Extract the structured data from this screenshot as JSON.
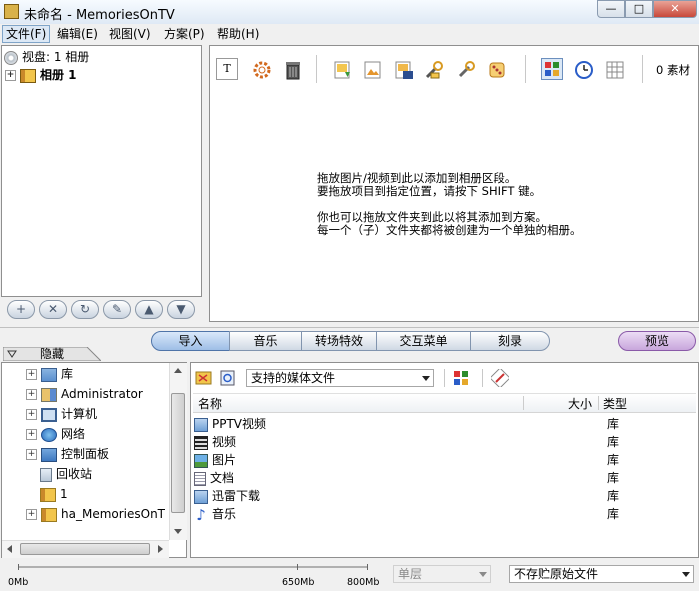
{
  "window": {
    "title": "未命名 - MemoriesOnTV",
    "min_glyph": "—",
    "max_glyph": "□",
    "close_glyph": "✕"
  },
  "menu": [
    "文件(F)",
    "编辑(E)",
    "视图(V)",
    "方案(P)",
    "帮助(H)"
  ],
  "album_tree": {
    "disc_label": "视盘: 1 相册",
    "album_label": "相册 1"
  },
  "album_toolbar": [
    "+",
    "✕",
    "↻",
    "✎",
    "▲",
    "▼"
  ],
  "media": {
    "count_label": "0 素材",
    "hint_lines": [
      "拖放图片/视频到此以添加到相册区段。",
      "要拖放项目到指定位置，请按下 SHIFT 键。",
      "",
      "你也可以拖放文件夹到此以将其添加到方案。",
      "每一个（子）文件夹都将被创建为一个单独的相册。"
    ]
  },
  "tabs": [
    "导入",
    "音乐",
    "转场特效",
    "交互菜单",
    "刻录"
  ],
  "preview_label": "预览",
  "hide_label": "隐藏",
  "folder_tree": [
    {
      "label": "库",
      "icon": "library-icon",
      "expand": true
    },
    {
      "label": "Administrator",
      "icon": "user-icon",
      "expand": true
    },
    {
      "label": "计算机",
      "icon": "computer-icon",
      "expand": true
    },
    {
      "label": "网络",
      "icon": "network-icon",
      "expand": true
    },
    {
      "label": "控制面板",
      "icon": "control-panel-icon",
      "expand": true
    },
    {
      "label": "回收站",
      "icon": "recycle-bin-icon",
      "expand": false
    },
    {
      "label": "1",
      "icon": "folder-icon",
      "expand": false
    },
    {
      "label": "ha_MemoriesOnT",
      "icon": "folder-icon",
      "expand": true
    }
  ],
  "file_pane": {
    "filter_value": "支持的媒体文件",
    "columns": {
      "name": "名称",
      "size": "大小",
      "type": "类型"
    },
    "rows": [
      {
        "name": "PPTV视频",
        "size": "",
        "type": "库"
      },
      {
        "name": "视频",
        "size": "",
        "type": "库"
      },
      {
        "name": "图片",
        "size": "",
        "type": "库"
      },
      {
        "name": "文档",
        "size": "",
        "type": "库"
      },
      {
        "name": "迅雷下载",
        "size": "",
        "type": "库"
      },
      {
        "name": "音乐",
        "size": "",
        "type": "库"
      }
    ]
  },
  "status": {
    "scale_labels": [
      "0Mb",
      "650Mb",
      "800Mb"
    ],
    "layer_value": "单层",
    "storage_value": "不存贮原始文件"
  },
  "colors": {
    "accent": "#3d78c8",
    "preview_purple": "#c8a6dc",
    "title_bar": "#dfe9f5"
  }
}
